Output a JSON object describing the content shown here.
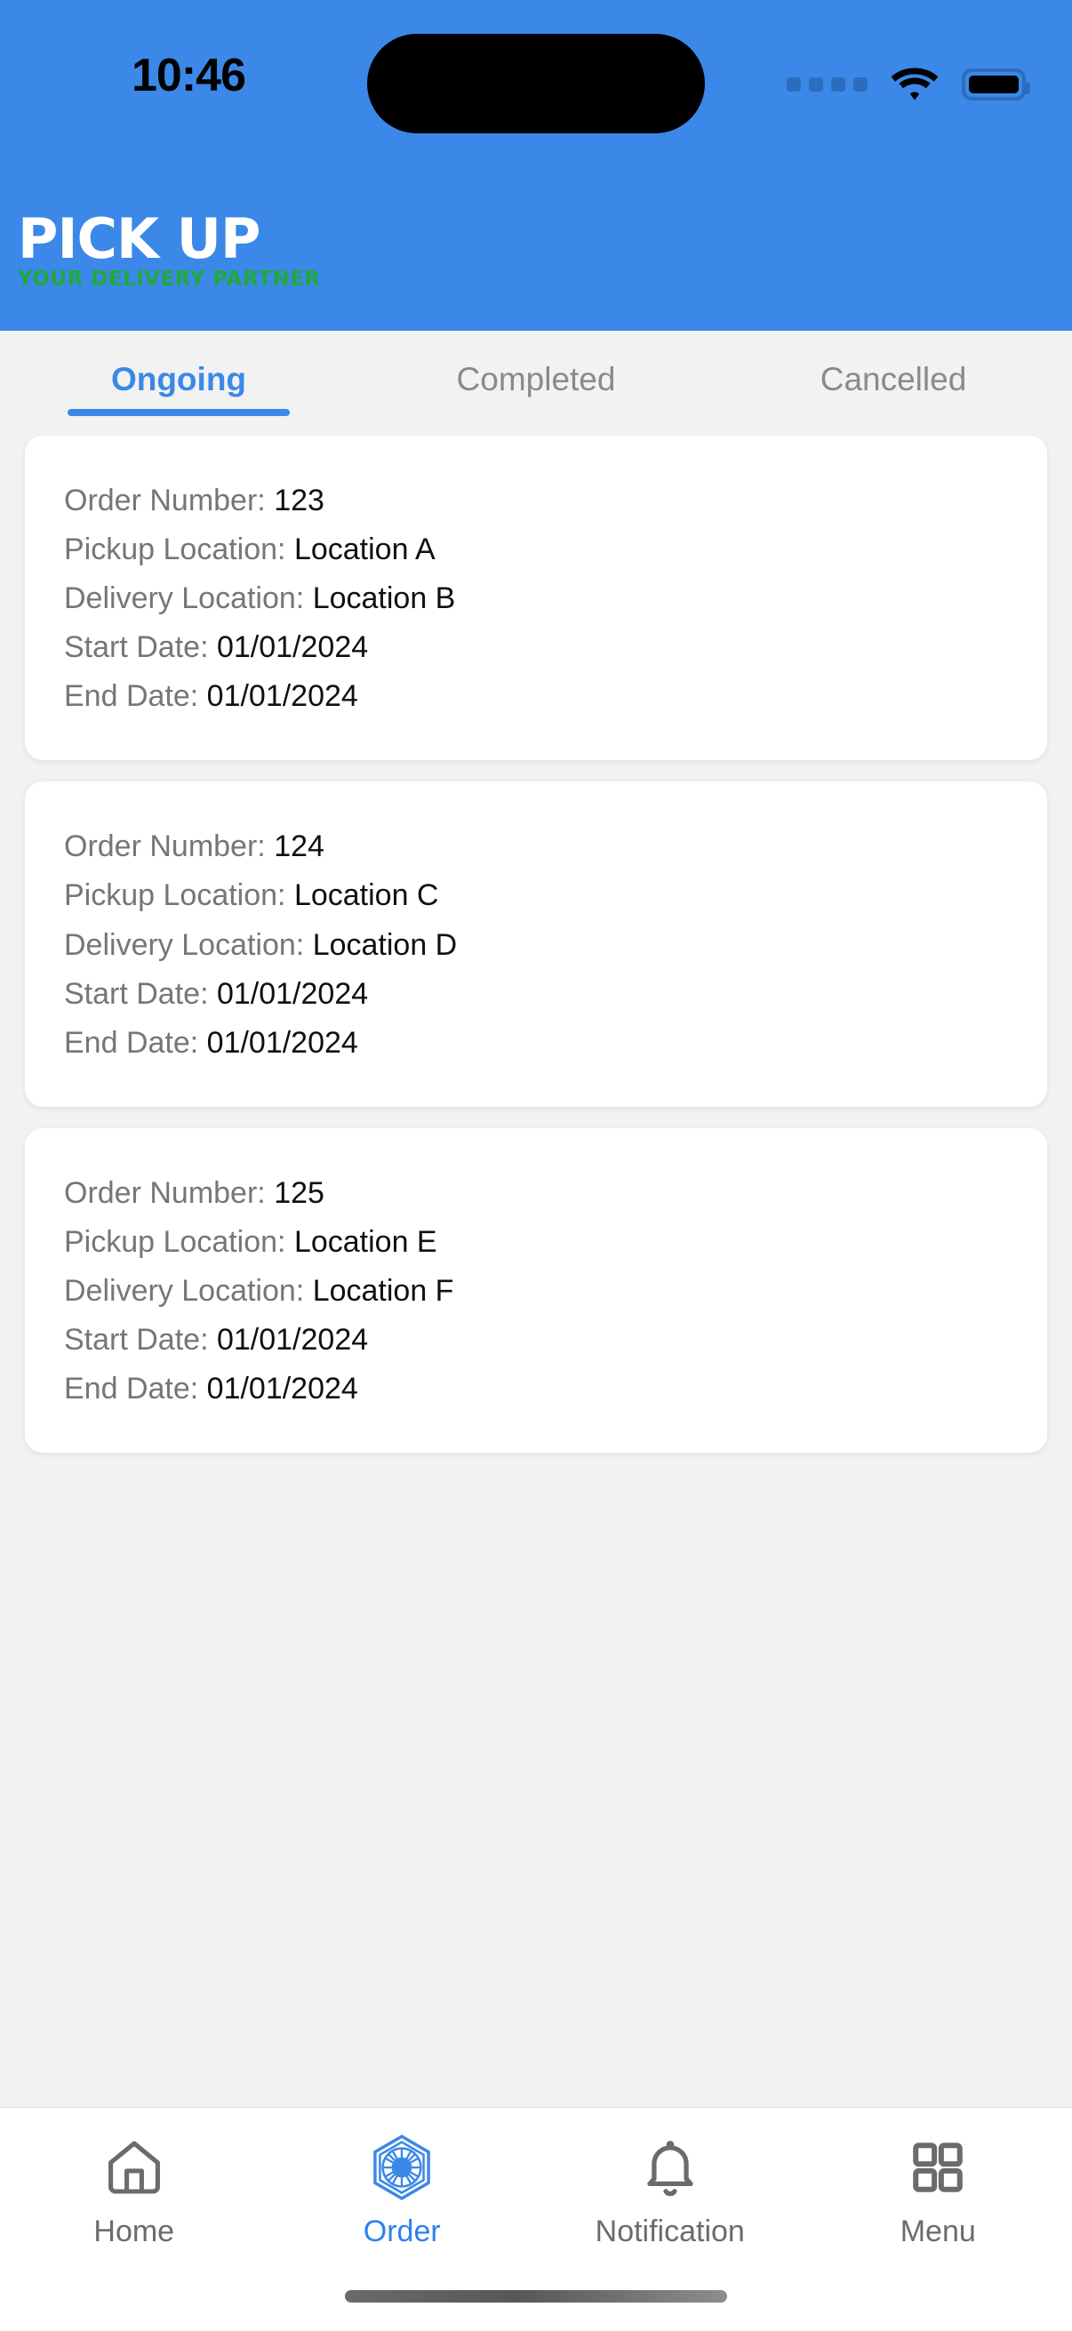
{
  "status_bar": {
    "time": "10:46",
    "signal_icon": "signal-dots-icon",
    "wifi_icon": "wifi-icon",
    "battery_icon": "battery-icon"
  },
  "header": {
    "brand_title": "PICK UP",
    "brand_tagline": "YOUR DELIVERY PARTNER",
    "background_color": "#3b88e8",
    "tagline_color": "#22a83c"
  },
  "tabs": [
    {
      "label": "Ongoing",
      "active": true
    },
    {
      "label": "Completed",
      "active": false
    },
    {
      "label": "Cancelled",
      "active": false
    }
  ],
  "orders": [
    {
      "order_number_label": "Order Number:",
      "order_number": "123",
      "pickup_label": "Pickup Location:",
      "pickup": "Location A",
      "delivery_label": "Delivery Location:",
      "delivery": "Location B",
      "start_label": "Start Date:",
      "start_date": "01/01/2024",
      "end_label": "End Date:",
      "end_date": "01/01/2024"
    },
    {
      "order_number_label": "Order Number:",
      "order_number": "124",
      "pickup_label": "Pickup Location:",
      "pickup": "Location C",
      "delivery_label": "Delivery Location:",
      "delivery": "Location D",
      "start_label": "Start Date:",
      "start_date": "01/01/2024",
      "end_label": "End Date:",
      "end_date": "01/01/2024"
    },
    {
      "order_number_label": "Order Number:",
      "order_number": "125",
      "pickup_label": "Pickup Location:",
      "pickup": "Location E",
      "delivery_label": "Delivery Location:",
      "delivery": "Location F",
      "start_label": "Start Date:",
      "start_date": "01/01/2024",
      "end_label": "End Date:",
      "end_date": "01/01/2024"
    }
  ],
  "bottom_nav": {
    "items": [
      {
        "label": "Home",
        "icon": "home-icon",
        "active": false
      },
      {
        "label": "Order",
        "icon": "order-hexagon-icon",
        "active": true
      },
      {
        "label": "Notification",
        "icon": "bell-icon",
        "active": false
      },
      {
        "label": "Menu",
        "icon": "grid-menu-icon",
        "active": false
      }
    ],
    "active_color": "#2f80ed",
    "inactive_color": "#6b6b6b"
  }
}
